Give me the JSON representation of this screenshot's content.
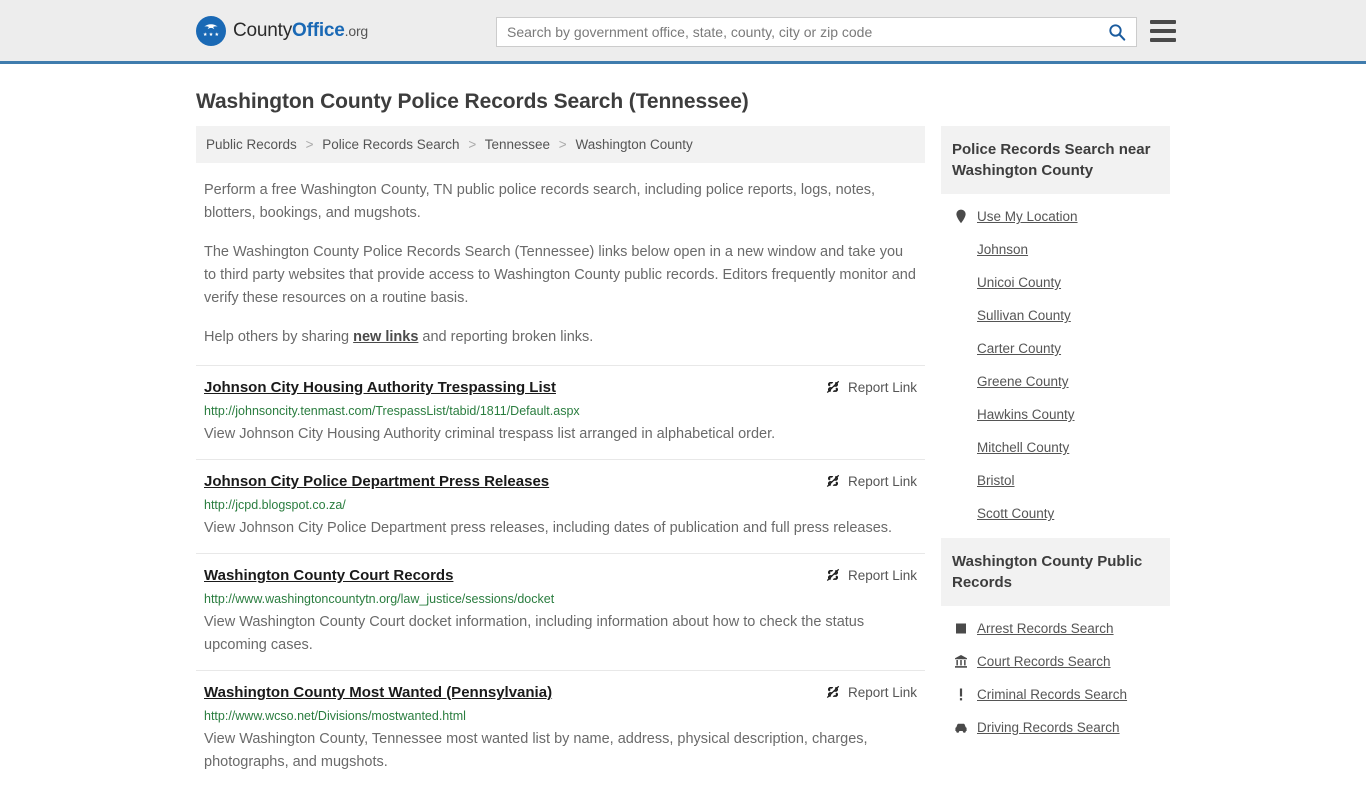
{
  "header": {
    "logo": {
      "name_part1": "County",
      "name_part2": "Office",
      "name_suffix": ".org",
      "eagle_glyph": "\u0001",
      "stars_glyph": "★★★"
    },
    "search": {
      "placeholder": "Search by government office, state, county, city or zip code",
      "value": "",
      "search_icon": "search-icon"
    },
    "menu_icon": "hamburger-menu-icon",
    "accent_color": "#3f7cad",
    "background_color": "#ededed"
  },
  "page": {
    "title": "Washington County Police Records Search (Tennessee)"
  },
  "breadcrumb": {
    "separator": ">",
    "items": [
      "Public Records",
      "Police Records Search",
      "Tennessee",
      "Washington County"
    ]
  },
  "intro": {
    "paragraph1": "Perform a free Washington County, TN public police records search, including police reports, logs, notes, blotters, bookings, and mugshots.",
    "paragraph2": "The Washington County Police Records Search (Tennessee) links below open in a new window and take you to third party websites that provide access to Washington County public records. Editors frequently monitor and verify these resources on a routine basis.",
    "paragraph3_before": "Help others by sharing ",
    "paragraph3_link": "new links",
    "paragraph3_after": " and reporting broken links."
  },
  "results": {
    "report_label": "Report Link",
    "report_icon": "broken-link-icon",
    "items": [
      {
        "title": "Johnson City Housing Authority Trespassing List",
        "url": "http://johnsoncity.tenmast.com/TrespassList/tabid/1811/Default.aspx",
        "description": "View Johnson City Housing Authority criminal trespass list arranged in alphabetical order."
      },
      {
        "title": "Johnson City Police Department Press Releases",
        "url": "http://jcpd.blogspot.co.za/",
        "description": "View Johnson City Police Department press releases, including dates of publication and full press releases."
      },
      {
        "title": "Washington County Court Records",
        "url": "http://www.washingtoncountytn.org/law_justice/sessions/docket",
        "description": "View Washington County Court docket information, including information about how to check the status upcoming cases."
      },
      {
        "title": "Washington County Most Wanted (Pennsylvania)",
        "url": "http://www.wcso.net/Divisions/mostwanted.html",
        "description": "View Washington County, Tennessee most wanted list by name, address, physical description, charges, photographs, and mugshots."
      }
    ]
  },
  "sidebar": {
    "nearby": {
      "heading": "Police Records Search near Washington County",
      "items": [
        {
          "label": "Use My Location",
          "icon": "map-pin-icon"
        },
        {
          "label": "Johnson",
          "icon": ""
        },
        {
          "label": "Unicoi County",
          "icon": ""
        },
        {
          "label": "Sullivan County",
          "icon": ""
        },
        {
          "label": "Carter County",
          "icon": ""
        },
        {
          "label": "Greene County",
          "icon": ""
        },
        {
          "label": "Hawkins County",
          "icon": ""
        },
        {
          "label": "Mitchell County",
          "icon": ""
        },
        {
          "label": "Bristol",
          "icon": ""
        },
        {
          "label": "Scott County",
          "icon": ""
        }
      ]
    },
    "public_records": {
      "heading": "Washington County Public Records",
      "items": [
        {
          "label": "Arrest Records Search",
          "icon": "fingerprint-card-icon"
        },
        {
          "label": "Court Records Search",
          "icon": "courthouse-icon"
        },
        {
          "label": "Criminal Records Search",
          "icon": "exclamation-icon"
        },
        {
          "label": "Driving Records Search",
          "icon": "car-icon"
        }
      ]
    }
  }
}
